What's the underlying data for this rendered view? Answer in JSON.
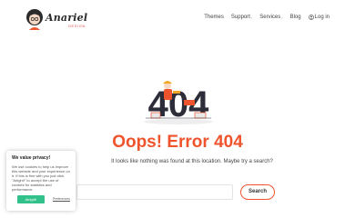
{
  "brand": {
    "name": "Anariel",
    "sub": "DESIGN"
  },
  "nav": {
    "items": [
      {
        "label": "Themes"
      },
      {
        "label": "Support",
        "caret": "›"
      },
      {
        "label": "Services",
        "caret": "›"
      },
      {
        "label": "Blog"
      }
    ],
    "login": "Log in"
  },
  "illustration": {
    "text": "404",
    "icon": "404-illustration-icon"
  },
  "error": {
    "title": "Oops! Error 404",
    "message": "It looks like nothing was found at this location. Maybe try a search?"
  },
  "search": {
    "value": "",
    "placeholder": "",
    "button": "Search"
  },
  "cookie": {
    "title": "We value privacy!",
    "text": "We use cookies to help us improve this website and your experience on it. If this is fine with you just click \"Alright!\" to accept the use of cookies for statistics and performance.",
    "accept": "Alright!",
    "preferences": "Preferences"
  },
  "colors": {
    "accent": "#f0542d",
    "accept": "#33c18b"
  }
}
